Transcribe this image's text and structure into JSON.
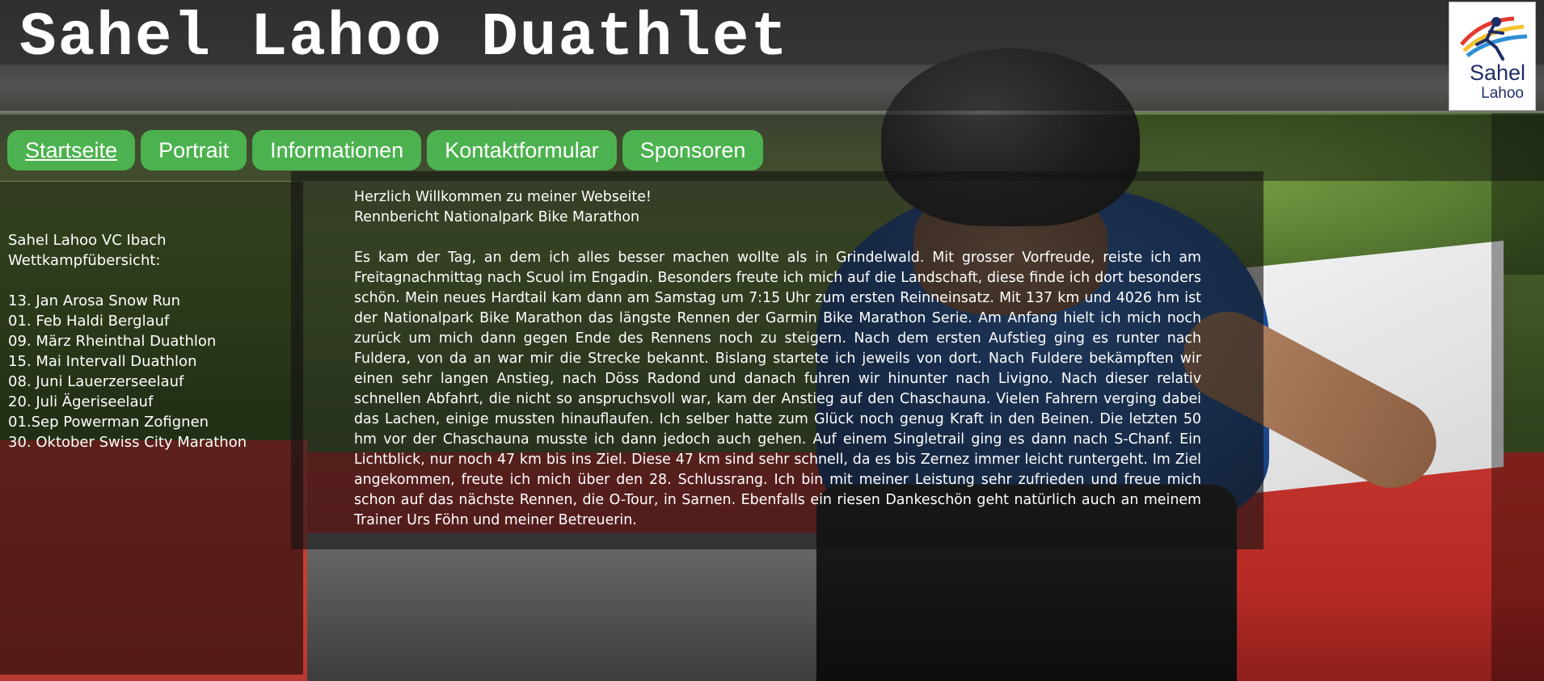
{
  "site": {
    "title": "Sahel Lahoo Duathlet",
    "logo": {
      "line1": "Sahel",
      "line2": "Lahoo"
    }
  },
  "nav": {
    "items": [
      {
        "label": "Startseite",
        "active": true
      },
      {
        "label": "Portrait",
        "active": false
      },
      {
        "label": "Informationen",
        "active": false
      },
      {
        "label": "Kontaktformular",
        "active": false
      },
      {
        "label": "Sponsoren",
        "active": false
      }
    ]
  },
  "sidebar": {
    "club": "Sahel Lahoo VC Ibach",
    "heading": "Wettkampfübersicht:",
    "events": [
      "13. Jan Arosa Snow Run",
      "01. Feb Haldi Berglauf",
      "09. März Rheinthal Duathlon",
      "15. Mai Intervall Duathlon",
      "08. Juni Lauerzerseelauf",
      "20. Juli Ägeriseelauf",
      "01.Sep Powerman Zofignen",
      "30. Oktober Swiss City Marathon"
    ]
  },
  "main": {
    "welcome": "Herzlich Willkommen zu meiner Webseite!",
    "report_title": "Rennbericht Nationalpark Bike Marathon",
    "body": "Es kam der Tag, an dem ich alles besser machen wollte als in Grindelwald. Mit grosser Vorfreude, reiste ich am Freitagnachmittag nach Scuol im Engadin. Besonders freute ich mich auf die Landschaft, diese finde ich dort besonders schön. Mein neues Hardtail kam dann am Samstag um 7:15 Uhr zum ersten Reinneinsatz. Mit 137 km und 4026 hm ist der Nationalpark Bike Marathon das längste Rennen der Garmin Bike Marathon Serie. Am Anfang hielt ich mich noch zurück um mich dann gegen Ende des Rennens noch zu steigern. Nach dem ersten Aufstieg ging es runter nach Fuldera, von da an war mir die Strecke bekannt. Bislang startete ich jeweils von dort. Nach Fuldere bekämpften wir einen sehr langen Anstieg, nach Döss Radond und danach fuhren wir hinunter nach Livigno. Nach dieser relativ schnellen Abfahrt, die nicht so anspruchsvoll war, kam der Anstieg auf den Chaschauna. Vielen Fahrern verging dabei das Lachen, einige mussten hinauflaufen. Ich selber hatte zum Glück noch genug Kraft in den Beinen. Die letzten 50 hm vor der Chaschauna musste ich dann jedoch auch gehen. Auf einem Singletrail ging es dann nach S-Chanf. Ein Lichtblick, nur noch 47 km bis ins Ziel. Diese 47 km sind sehr schnell, da es bis Zernez immer leicht runtergeht. Im Ziel angekommen, freute ich mich über den 28. Schlussrang. Ich bin mit meiner Leistung sehr zufrieden und freue mich schon auf das nächste Rennen, die O-Tour, in Sarnen. Ebenfalls ein riesen Dankeschön geht natürlich auch an meinem Trainer Urs Föhn und meiner Betreuerin."
  }
}
